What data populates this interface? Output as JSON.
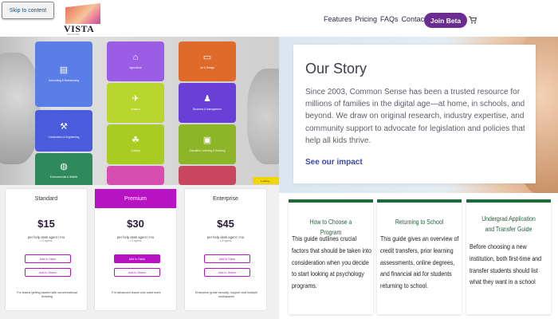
{
  "header": {
    "skip_label": "Skip to content",
    "logo_text": "VISTA",
    "logo_sub": "INSTITUTE",
    "nav": [
      "Features",
      "Pricing",
      "FAQs",
      "Contact"
    ],
    "join_label": "Join Beta"
  },
  "hero": {
    "tiles": [
      {
        "label": "Accounting & Bookkeeping",
        "color": "#5a7ee8",
        "icon": "clipboard-icon"
      },
      {
        "label": "Agriculture",
        "color": "#9b5ce6",
        "icon": "barn-icon"
      },
      {
        "label": "Art & Design",
        "color": "#e06a2a",
        "icon": "monitor-icon"
      },
      {
        "label": "Aviation",
        "color": "#b9d62e",
        "icon": "airplane-icon"
      },
      {
        "label": "Business & Management",
        "color": "#6a3fd8",
        "icon": "team-icon"
      },
      {
        "label": "Construction & Engineering",
        "color": "#4a5cdc",
        "icon": "wrench-icon"
      },
      {
        "label": "Culinary",
        "color": "#a9cc22",
        "icon": "chef-icon"
      },
      {
        "label": "Education, Learning & Teaching",
        "color": "#8cb628",
        "icon": "teacher-icon"
      },
      {
        "label": "Environmental & Wildlife",
        "color": "#2e8a5a",
        "icon": "globe-icon"
      },
      {
        "label": "",
        "color": "#d64fb0",
        "icon": ""
      },
      {
        "label": "",
        "color": "#c8475e",
        "icon": ""
      }
    ],
    "corner_badge": "Loading..."
  },
  "story": {
    "title": "Our Story",
    "body": "Since 2003, Common Sense has been a trusted resource for millions of families in the digital age—at home, in schools, and beyond. We draw on original research, industry expertise, and community support to advocate for legislation and policies that help all kids thrive.",
    "link": "See our impact"
  },
  "pricing": {
    "plans": [
      {
        "name": "Standard",
        "price": "$15",
        "per": "per help desk agent / mo",
        "per2": "1-5 agents",
        "slack": "Add to Slack",
        "teams": "Add to Teams",
        "foot": "For teams getting started with conversational ticketing"
      },
      {
        "name": "Premium",
        "price": "$30",
        "per": "per help desk agent / mo",
        "per2": "1-5 agents",
        "slack": "Add to Slack",
        "teams": "Add to Teams",
        "foot": "For advanced teams who want more"
      },
      {
        "name": "Enterprise",
        "price": "$45",
        "per": "per help desk agent / mo",
        "per2": "1-5 agents",
        "slack": "Add to Slack",
        "teams": "Add to Teams",
        "foot": "Enterprise grade security, support and multiple workspaces"
      }
    ]
  },
  "guides": [
    {
      "title": "How to Choose a Program",
      "text": "This guide outlines crucial factors that should be taken into consideration when you decide to start looking at psychology programs."
    },
    {
      "title": "Returning to School",
      "text": "This guide gives an overview of credit transfers, prior learning assessments, online degrees, and financial aid for students returning to school."
    },
    {
      "title": "Undergrad Application and Transfer Guide",
      "text": "Before choosing a new institution, both first-time and transfer students should list what they want in a school"
    }
  ],
  "colors": {
    "brand": "#6a2c8f",
    "premium": "#b813c2",
    "guide_green": "#1f6a3a",
    "link": "#3b4aa0"
  }
}
